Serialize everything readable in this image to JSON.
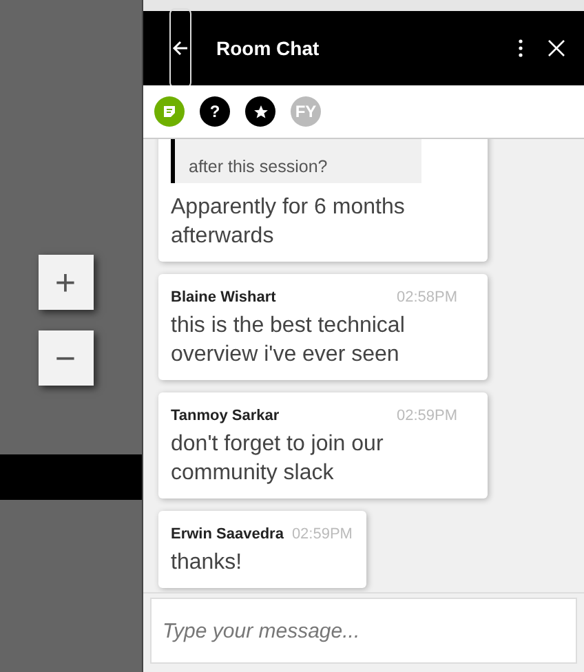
{
  "map_controls": [
    {
      "label": "+"
    },
    {
      "label": "−"
    }
  ],
  "header": {
    "title": "Room Chat"
  },
  "toolbar": [
    {
      "kind": "notes",
      "selected": true
    },
    {
      "kind": "help",
      "label": "?",
      "selected": false
    },
    {
      "kind": "favorites",
      "selected": false
    },
    {
      "kind": "avatar",
      "label": "FY",
      "selected": false
    }
  ],
  "messages": [
    {
      "quote": "after this session?",
      "text": "Apparently for 6 months afterwards"
    },
    {
      "author": "Blaine Wishart",
      "time": "02:58PM",
      "text": "this is the best technical overview i've ever seen"
    },
    {
      "author": "Tanmoy Sarkar",
      "time": "02:59PM",
      "text": "don't forget to join our community slack"
    },
    {
      "author": "Erwin Saavedra",
      "time": "02:59PM",
      "text": "thanks!"
    }
  ],
  "composer": {
    "placeholder": "Type your message..."
  }
}
